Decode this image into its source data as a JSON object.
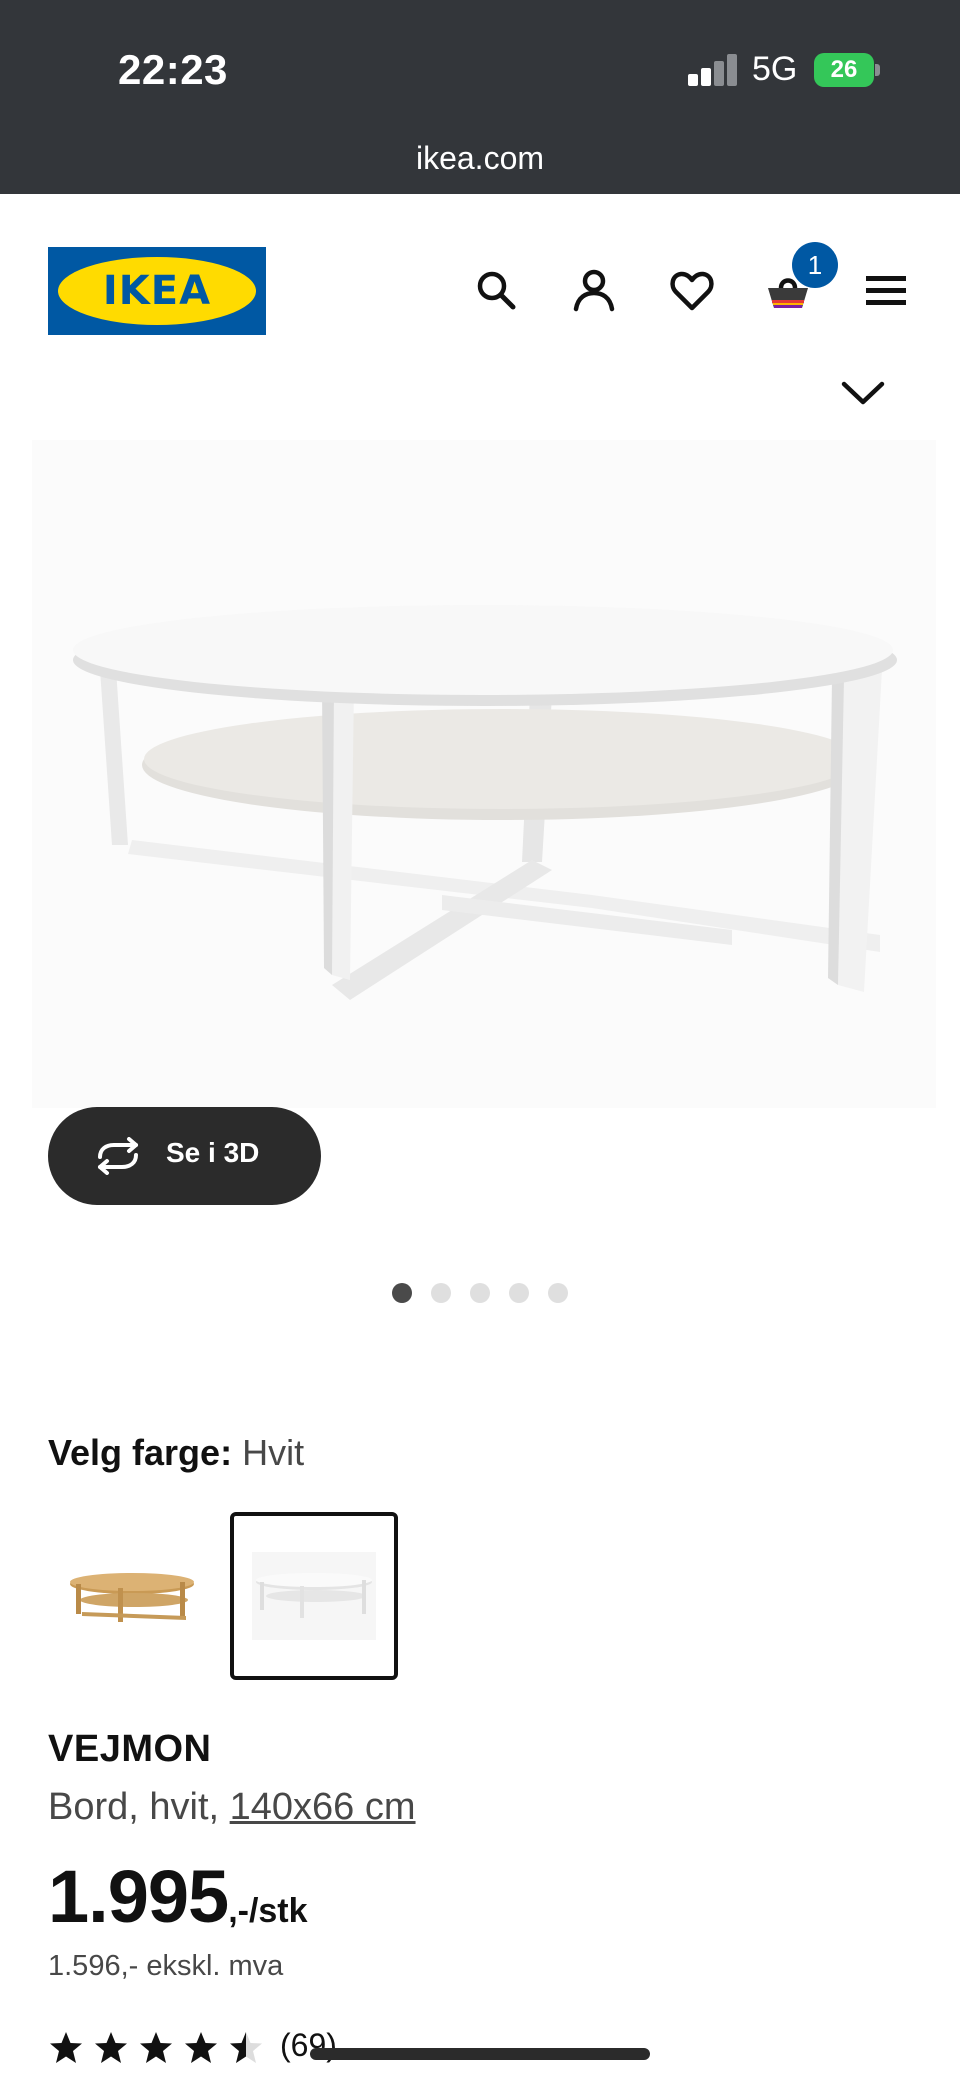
{
  "status_bar": {
    "time": "22:23",
    "network": "5G",
    "battery": "26"
  },
  "browser": {
    "url": "ikea.com"
  },
  "header": {
    "logo_text": "IKEA",
    "cart_count": "1",
    "icons": [
      "search-icon",
      "account-icon",
      "heart-icon",
      "cart-icon",
      "menu-icon"
    ]
  },
  "gallery": {
    "view_3d_label": "Se i 3D",
    "image_count": 5,
    "active_index": 0
  },
  "color_picker": {
    "label": "Velg farge:",
    "selected_value": "Hvit",
    "options": [
      "oak-variant",
      "white-variant"
    ],
    "selected_index": 1
  },
  "product": {
    "name": "VEJMON",
    "description_prefix": "Bord, hvit, ",
    "size_link": "140x66 cm",
    "price_main": "1.995",
    "price_suffix": ",-/stk",
    "price_ex_vat": "1.596,- ekskl. mva",
    "rating": 4.5,
    "review_count": "(69)"
  },
  "colors": {
    "status_bg": "#33363a",
    "ikea_blue": "#0058a3",
    "ikea_yellow": "#ffdb00",
    "battery_green": "#34c759",
    "button_dark": "#2b2b2b"
  }
}
